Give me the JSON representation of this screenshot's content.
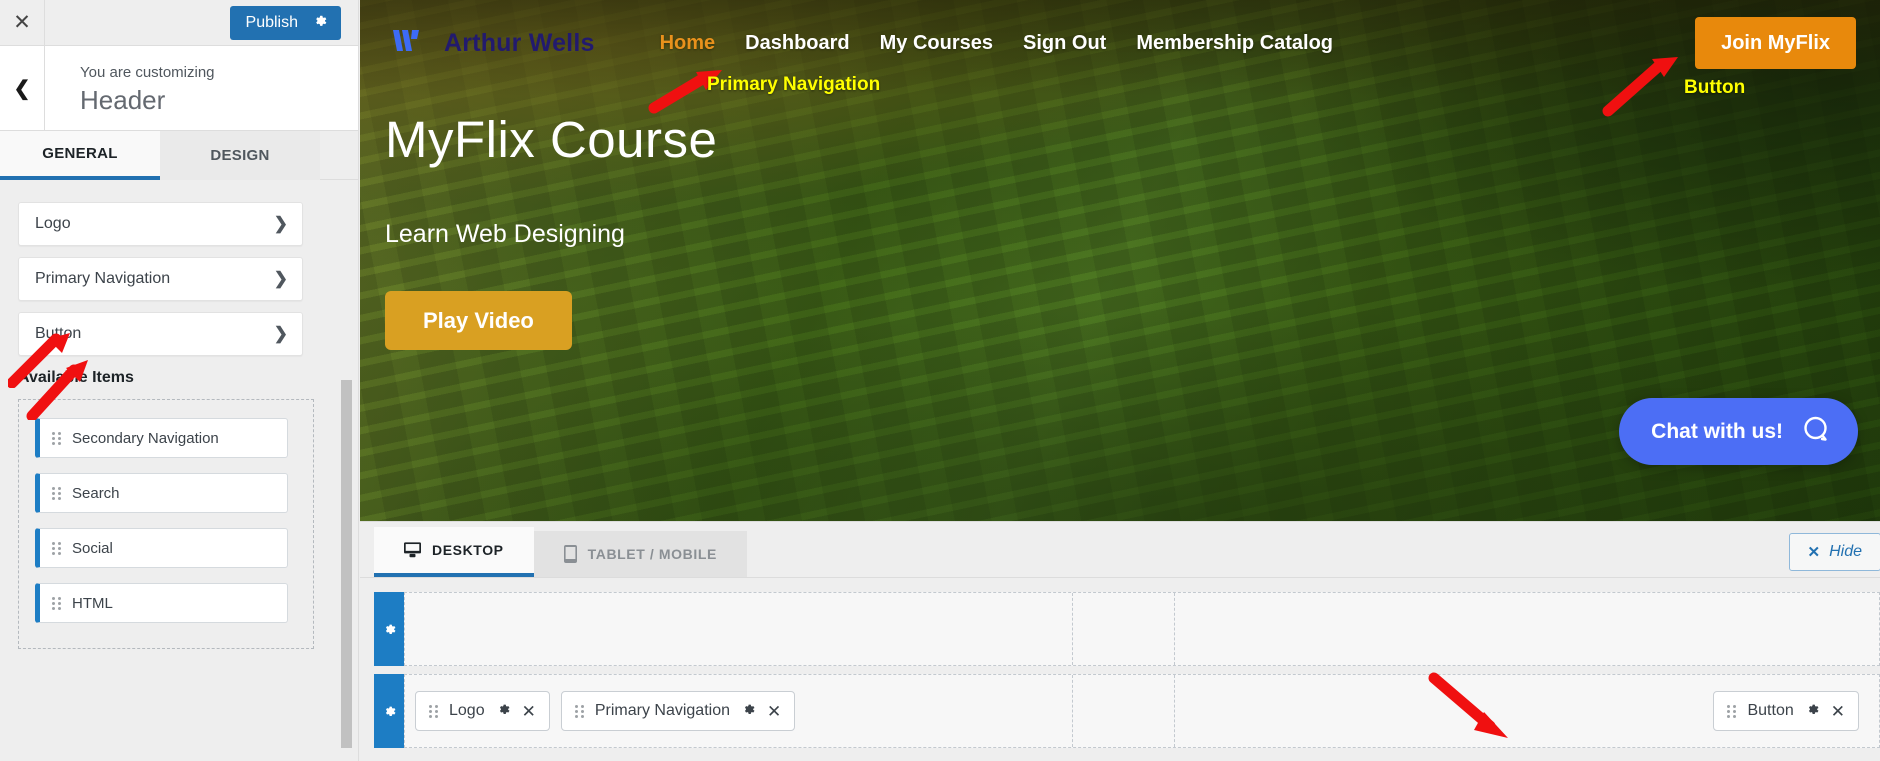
{
  "customizer": {
    "close_icon": "close-icon",
    "publish_label": "Publish",
    "publish_gear_icon": "gear-icon",
    "back_icon": "chevron-left-icon",
    "customizing_label": "You are customizing",
    "panel_title": "Header",
    "tabs": [
      {
        "label": "GENERAL",
        "active": true
      },
      {
        "label": "DESIGN",
        "active": false
      }
    ],
    "rows": [
      {
        "label": "Logo",
        "chevron": "chevron-right-icon"
      },
      {
        "label": "Primary Navigation",
        "chevron": "chevron-right-icon"
      },
      {
        "label": "Button",
        "chevron": "chevron-right-icon"
      }
    ],
    "available_title": "Available Items",
    "available_items": [
      {
        "label": "Secondary Navigation"
      },
      {
        "label": "Search"
      },
      {
        "label": "Social"
      },
      {
        "label": "HTML"
      }
    ]
  },
  "preview": {
    "brand": {
      "name": "Arthur Wells",
      "mark_icon": "w-logo-icon"
    },
    "nav_links": [
      {
        "label": "Home",
        "current": true
      },
      {
        "label": "Dashboard",
        "current": false
      },
      {
        "label": "My Courses",
        "current": false
      },
      {
        "label": "Sign Out",
        "current": false
      },
      {
        "label": "Membership Catalog",
        "current": false
      }
    ],
    "join_button": "Join MyFlix",
    "hero_title": "MyFlix Course",
    "hero_subtitle": "Learn Web Designing",
    "play_button": "Play Video",
    "chat": {
      "label": "Chat with us!",
      "icon": "chat-bubble-icon"
    }
  },
  "builder": {
    "tabs": [
      {
        "label": "DESKTOP",
        "icon": "desktop-icon",
        "active": true
      },
      {
        "label": "TABLET / MOBILE",
        "icon": "mobile-icon",
        "active": false
      }
    ],
    "hide_label": "Hide",
    "hide_icon": "close-icon",
    "row_gear_icon": "gear-icon",
    "rows": [
      {
        "items": []
      },
      {
        "items": [
          {
            "label": "Logo",
            "gear": "gear-icon",
            "close": "close-icon"
          },
          {
            "label": "Primary Navigation",
            "gear": "gear-icon",
            "close": "close-icon"
          }
        ],
        "right_items": [
          {
            "label": "Button",
            "gear": "gear-icon",
            "close": "close-icon"
          }
        ]
      }
    ]
  },
  "annotations": {
    "primary_navigation": "Primary Navigation",
    "button": "Button"
  },
  "colors": {
    "publish_blue": "#2271b1",
    "accent_orange": "#e8890c",
    "play_orange": "#d9a022",
    "chat_blue": "#4c6ef5",
    "annotation_yellow": "#ffff00",
    "arrow_red": "#f01010",
    "brand_navy": "#221a6e",
    "nav_active_orange": "#e8911c"
  }
}
